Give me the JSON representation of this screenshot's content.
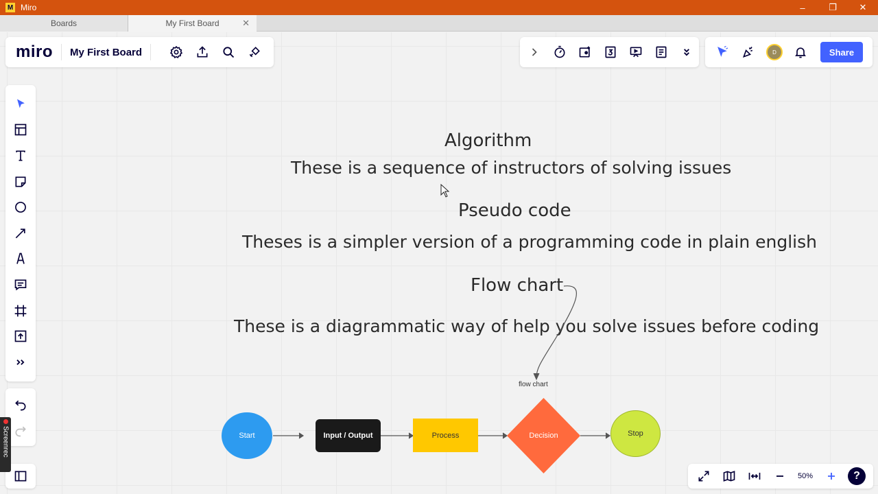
{
  "window": {
    "title": "Miro",
    "app_icon_glyph": "M",
    "controls": [
      "–",
      "❐",
      "✕"
    ]
  },
  "tabs": [
    {
      "label": "Boards"
    },
    {
      "label": "My First Board",
      "close": "✕"
    }
  ],
  "toolbar": {
    "logo": "miro",
    "board_name": "My First Board",
    "share_label": "Share",
    "avatar_initial": "D"
  },
  "zoom": {
    "level": "50%"
  },
  "help_glyph": "?",
  "recorder": {
    "label": "Screenrec"
  },
  "board": {
    "algorithm_title": "Algorithm",
    "algorithm_desc": "These is a sequence of instructors of solving issues",
    "pseudo_title": "Pseudo code",
    "pseudo_desc": "Theses is a simpler version of a programming code in plain english",
    "flow_title": "Flow chart",
    "flow_desc": "These is a diagrammatic way of help you solve issues before coding",
    "flow_note": "flow chart",
    "shapes": {
      "start": "Start",
      "io": "Input / Output",
      "process": "Process",
      "decision": "Decision",
      "stop": "Stop"
    }
  },
  "colors": {
    "titlebar": "#d4530e",
    "share": "#4262ff",
    "start": "#2d9bf0",
    "io": "#1a1a1a",
    "process": "#ffc800",
    "decision": "#ff6a3d",
    "stop": "#cee741"
  }
}
